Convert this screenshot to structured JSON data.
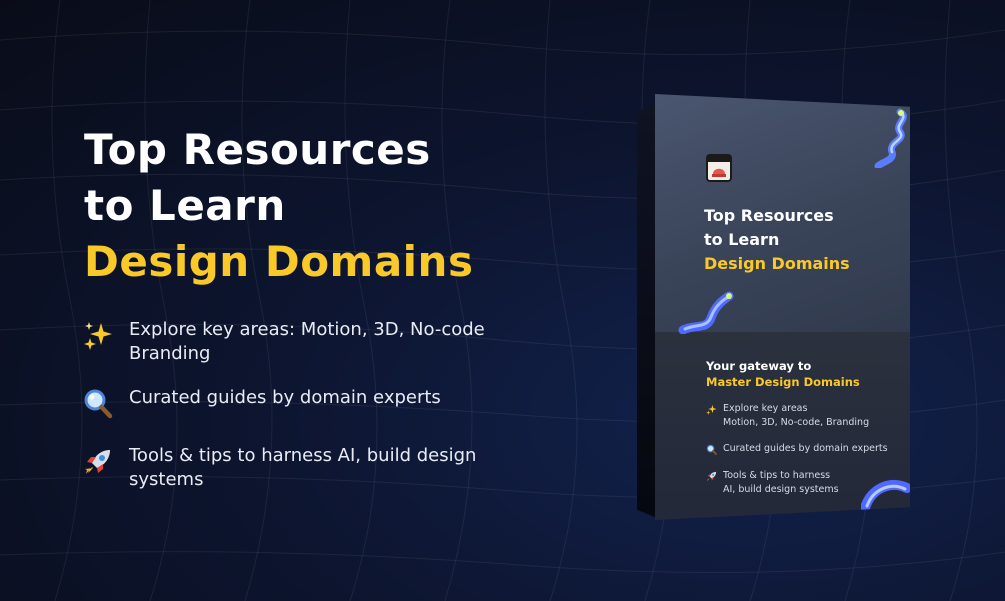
{
  "hero": {
    "title_line1": "Top Resources",
    "title_line2": "to Learn",
    "title_accent": "Design Domains"
  },
  "features": [
    {
      "icon": "sparkles-icon",
      "text": "Explore key areas: Motion, 3D, No-code Branding"
    },
    {
      "icon": "magnifying-glass-icon",
      "text": "Curated guides by domain experts"
    },
    {
      "icon": "rocket-icon",
      "text": "Tools & tips to harness AI, build design systems"
    }
  ],
  "box": {
    "logo_icon": "book-logo-icon",
    "title_line1": "Top Resources",
    "title_line2": "to Learn",
    "title_accent": "Design Domains",
    "gateway_line1": "Your gateway to",
    "gateway_accent": "Master Design Domains",
    "items": [
      {
        "icon": "sparkles-icon",
        "line1": "Explore key areas",
        "line2": "Motion, 3D, No-code, Branding"
      },
      {
        "icon": "magnifying-glass-icon",
        "line1": "Curated guides by domain experts",
        "line2": ""
      },
      {
        "icon": "rocket-icon",
        "line1": "Tools & tips to harness",
        "line2": "AI, build design systems"
      }
    ]
  },
  "colors": {
    "accent": "#f9c92a",
    "background": "#0d1530",
    "text": "#ffffff"
  }
}
